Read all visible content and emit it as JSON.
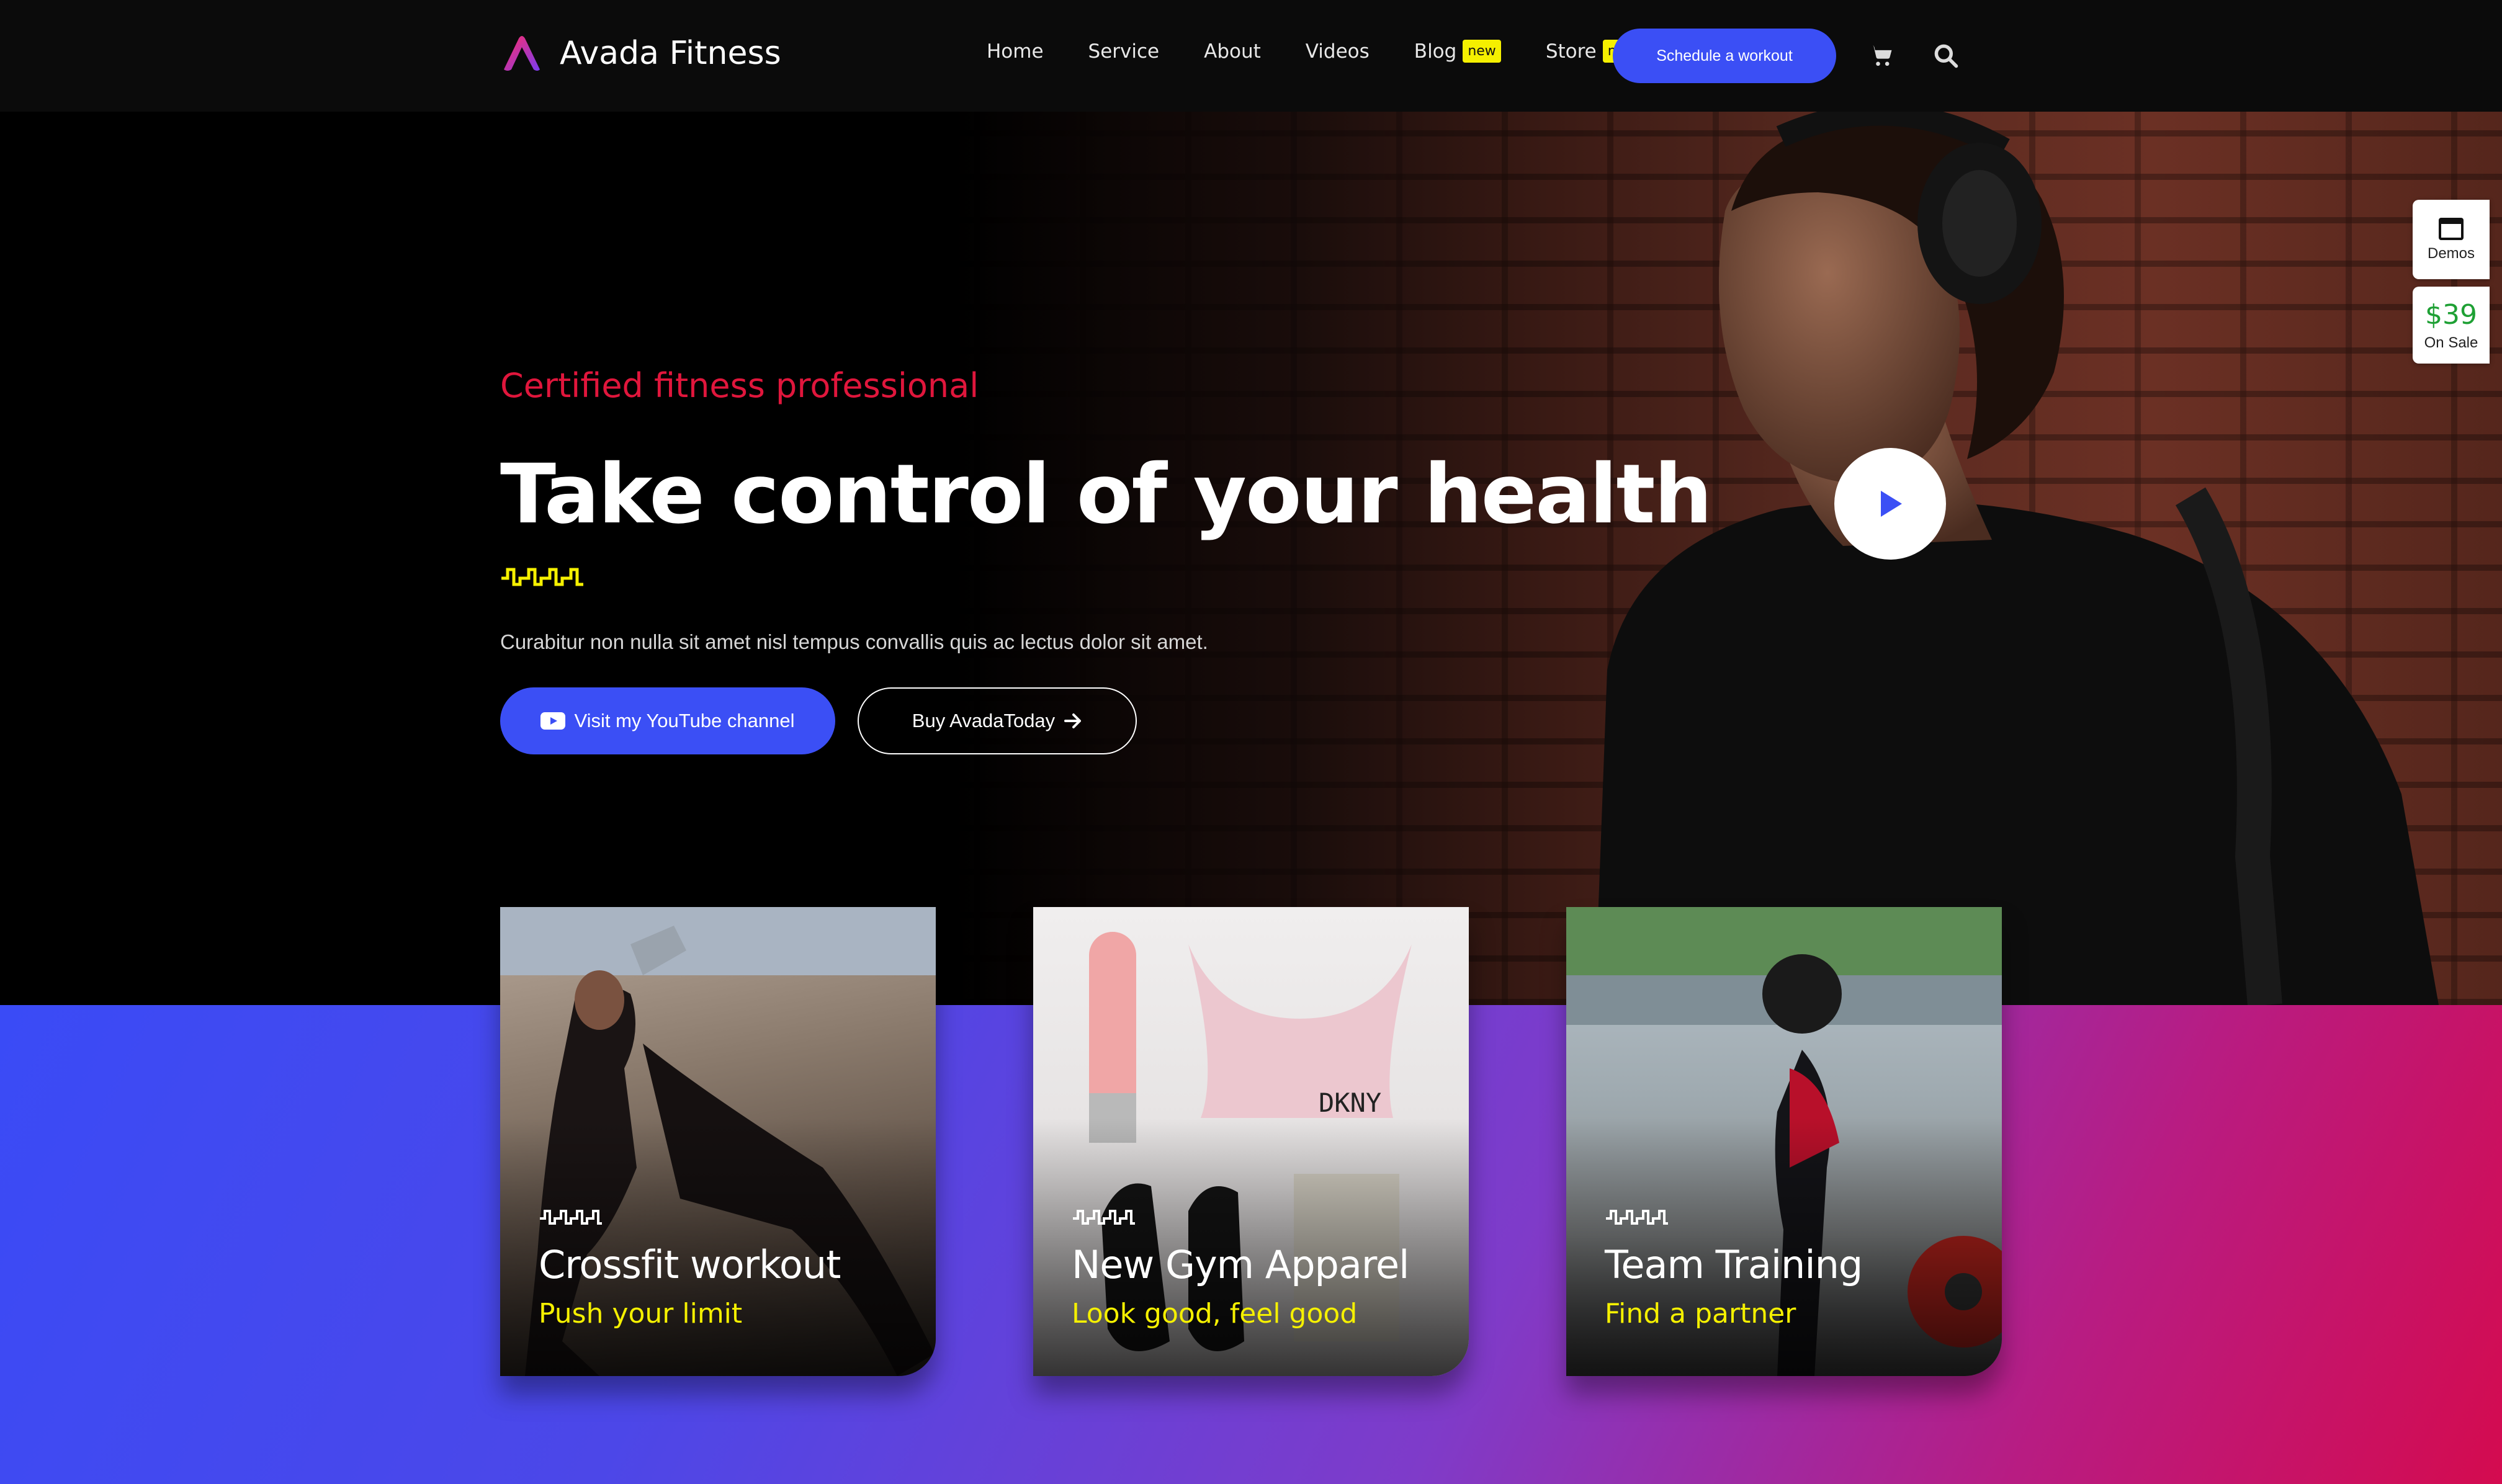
{
  "header": {
    "brand": "Avada Fitness",
    "nav": [
      {
        "label": "Home",
        "badge": ""
      },
      {
        "label": "Service",
        "badge": ""
      },
      {
        "label": "About",
        "badge": ""
      },
      {
        "label": "Videos",
        "badge": ""
      },
      {
        "label": "Blog",
        "badge": "new"
      },
      {
        "label": "Store",
        "badge": "new"
      }
    ],
    "cta": "Schedule a workout",
    "icons": [
      "cart-icon",
      "search-icon"
    ]
  },
  "hero": {
    "subtitle": "Certified fitness professional",
    "title": "Take control of your health",
    "description": "Curabitur non nulla sit amet nisl tempus convallis quis ac lectus dolor sit amet.",
    "primary_button": "Visit my YouTube channel",
    "secondary_button": "Buy AvadaToday"
  },
  "side_tabs": {
    "demos": "Demos",
    "price": "$39",
    "sale": "On Sale"
  },
  "cards": [
    {
      "title": "Crossfit workout",
      "subtitle": "Push your limit"
    },
    {
      "title": "New Gym Apparel",
      "subtitle": "Look good, feel good"
    },
    {
      "title": "Team Training",
      "subtitle": "Find a partner"
    }
  ],
  "colors": {
    "accent_blue": "#3b4ff5",
    "accent_red": "#e0163c",
    "accent_yellow": "#f5f000"
  }
}
